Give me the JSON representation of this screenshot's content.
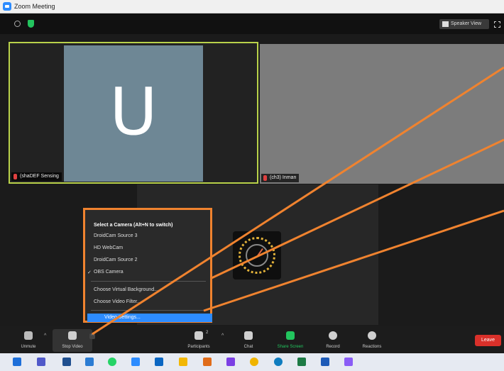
{
  "window": {
    "title": "Zoom Meeting"
  },
  "topbar": {
    "view_label": "Speaker View"
  },
  "participants": {
    "tile1": {
      "initial": "U",
      "name": "(shaDEF Sensing"
    },
    "tile2": {
      "name": "(ch3) Inman"
    }
  },
  "camera_menu": {
    "heading": "Select a Camera (Alt+N to switch)",
    "cameras": [
      "DroidCam Source 3",
      "HD WebCam",
      "DroidCam Source 2",
      "OBS Camera"
    ],
    "selected_camera": "OBS Camera",
    "options": [
      "Choose Virtual Background...",
      "Choose Video Filter..."
    ],
    "highlighted_option": "Video Settings..."
  },
  "toolbar": {
    "unmute": "Unmute",
    "stop_video": "Stop Video",
    "participants": "Participants",
    "participants_count": "2",
    "chat": "Chat",
    "share_screen": "Share Screen",
    "record": "Record",
    "reactions": "Reactions",
    "leave": "Leave"
  },
  "colors": {
    "annotation_orange": "#f0832f",
    "active_speaker_border": "#b9d24a",
    "share_green": "#22c55e",
    "leave_red": "#d9302a",
    "highlight_blue": "#2d8cff"
  }
}
